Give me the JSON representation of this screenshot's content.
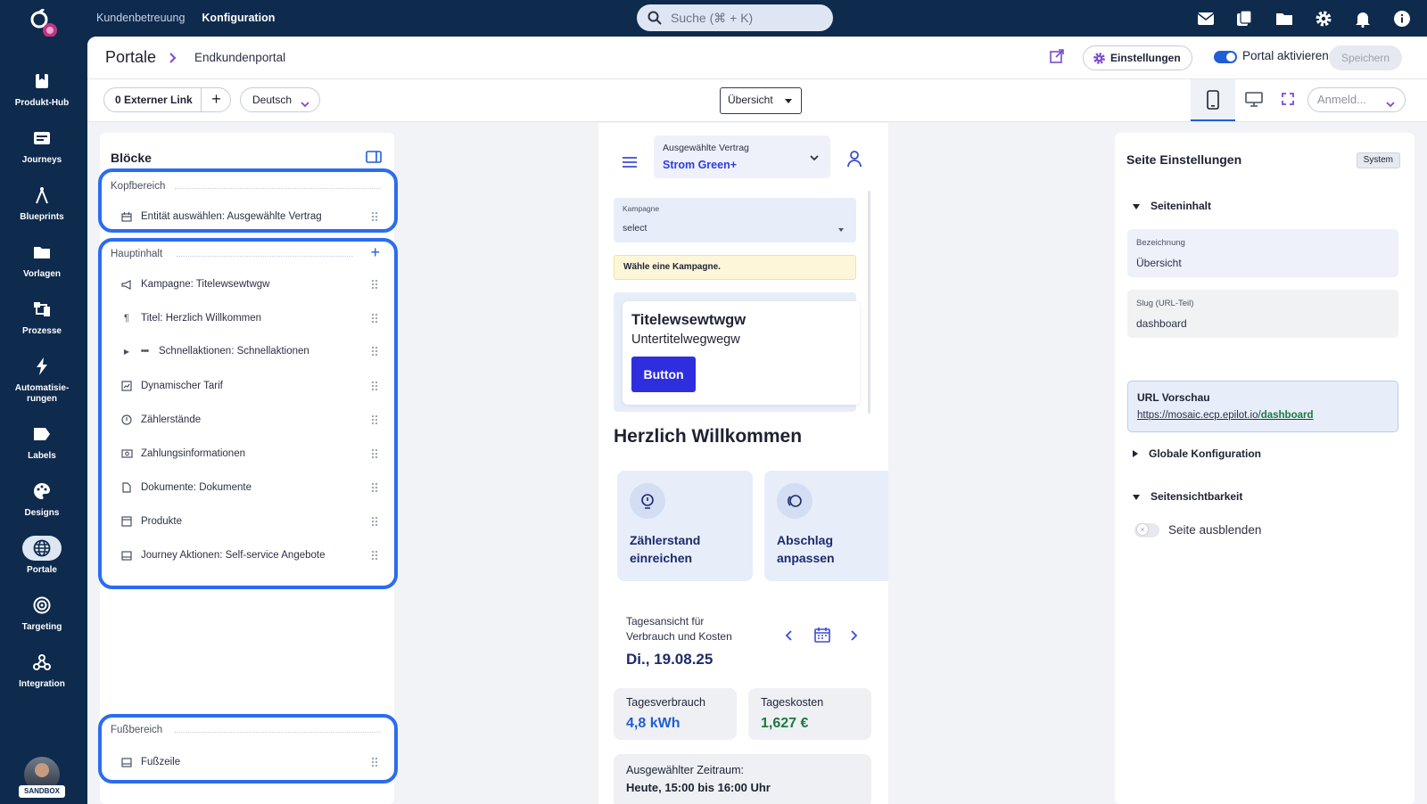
{
  "topbar": {
    "nav": [
      "Kundenbetreuung",
      "Konfiguration"
    ],
    "search_placeholder": "Suche (⌘ + K)",
    "icons": [
      "mail-icon",
      "copy-icon",
      "folder-icon",
      "gear-icon",
      "bell-icon",
      "info-icon"
    ]
  },
  "rail": [
    {
      "label": "Produkt-Hub",
      "icon": "bookmark-icon"
    },
    {
      "label": "Journeys",
      "icon": "journey-icon"
    },
    {
      "label": "Blueprints",
      "icon": "compass-icon"
    },
    {
      "label": "Vorlagen",
      "icon": "folder-icon"
    },
    {
      "label": "Prozesse",
      "icon": "process-icon"
    },
    {
      "label": "Automatisie-\nrungen",
      "icon": "lightning-icon"
    },
    {
      "label": "Labels",
      "icon": "label-icon"
    },
    {
      "label": "Designs",
      "icon": "palette-icon"
    },
    {
      "label": "Portale",
      "icon": "globe-icon",
      "active": true
    },
    {
      "label": "Targeting",
      "icon": "target-icon"
    },
    {
      "label": "Integration",
      "icon": "webhook-icon"
    }
  ],
  "rail_sandbox": "SANDBOX",
  "header": {
    "crumb_root": "Portale",
    "crumb_current": "Endkundenportal",
    "settings_label": "Einstellungen",
    "activate_label": "Portal aktivieren",
    "save_label": "Speichern"
  },
  "toolbar": {
    "external_link": "0 Externer Link",
    "language": "Deutsch",
    "page": "Übersicht",
    "login_placeholder": "Anmeld..."
  },
  "blocks": {
    "title": "Blöcke",
    "header_section": "Kopfbereich",
    "header_items": [
      {
        "label": "Entität auswählen: Ausgewählte Vertrag",
        "icon": "calendar-icon"
      }
    ],
    "main_section": "Hauptinhalt",
    "main_items": [
      {
        "label": "Kampagne: Titelewsewtwgw",
        "icon": "megaphone-icon"
      },
      {
        "label": "Titel: Herzlich Willkommen",
        "icon": "paragraph-icon"
      },
      {
        "label": "Schnellaktionen: Schnellaktionen",
        "icon": "dots-icon"
      },
      {
        "label": "Dynamischer Tarif",
        "icon": "tariff-icon"
      },
      {
        "label": "Zählerstände",
        "icon": "meter-icon"
      },
      {
        "label": "Zahlungsinformationen",
        "icon": "money-icon"
      },
      {
        "label": "Dokumente: Dokumente",
        "icon": "document-icon"
      },
      {
        "label": "Produkte",
        "icon": "box-icon"
      },
      {
        "label": "Journey Aktionen: Self-service Angebote",
        "icon": "window-icon"
      }
    ],
    "footer_section": "Fußbereich",
    "footer_items": [
      {
        "label": "Fußzeile",
        "icon": "footer-icon"
      }
    ]
  },
  "preview": {
    "contract_label": "Ausgewählte Vertrag",
    "contract_value": "Strom Green+",
    "campaign_label": "Kampagne",
    "campaign_value": "select",
    "warning": "Wähle eine Kampagne.",
    "card_title": "Titelewsewtwgw",
    "card_subtitle": "Untertitelwegwegw",
    "card_button": "Button",
    "greeting": "Herzlich Willkommen",
    "tiles": [
      "Zählerstand\neinreichen",
      "Abschlag\nanpassen"
    ],
    "day_title": "Tagesansicht für Verbrauch und Kosten",
    "date": "Di., 19.08.25",
    "metric_consumption_label": "Tagesverbrauch",
    "metric_consumption_value": "4,8 kWh",
    "metric_cost_label": "Tageskosten",
    "metric_cost_value": "1,627 €",
    "range_label": "Ausgewählter Zeitraum:",
    "range_value": "Heute, 15:00 bis 16:00 Uhr"
  },
  "settings": {
    "title": "Seite Einstellungen",
    "badge": "System",
    "section_content": "Seiteninhalt",
    "name_label": "Bezeichnung",
    "name_value": "Übersicht",
    "slug_label": "Slug (URL-Teil)",
    "slug_value": "dashboard",
    "url_label": "URL Vorschau",
    "url_base": "https://mosaic.ecp.epilot.io/",
    "url_slug": "dashboard",
    "section_global": "Globale Konfiguration",
    "section_visibility": "Seitensichtbarkeit",
    "hide_label": "Seite ausblenden"
  },
  "colors": {
    "navy": "#0e2a4d",
    "accent": "#1f5ed6",
    "highlight": "#2b6cf0",
    "cta": "#2f2edf",
    "cost": "#1b7a3e"
  }
}
